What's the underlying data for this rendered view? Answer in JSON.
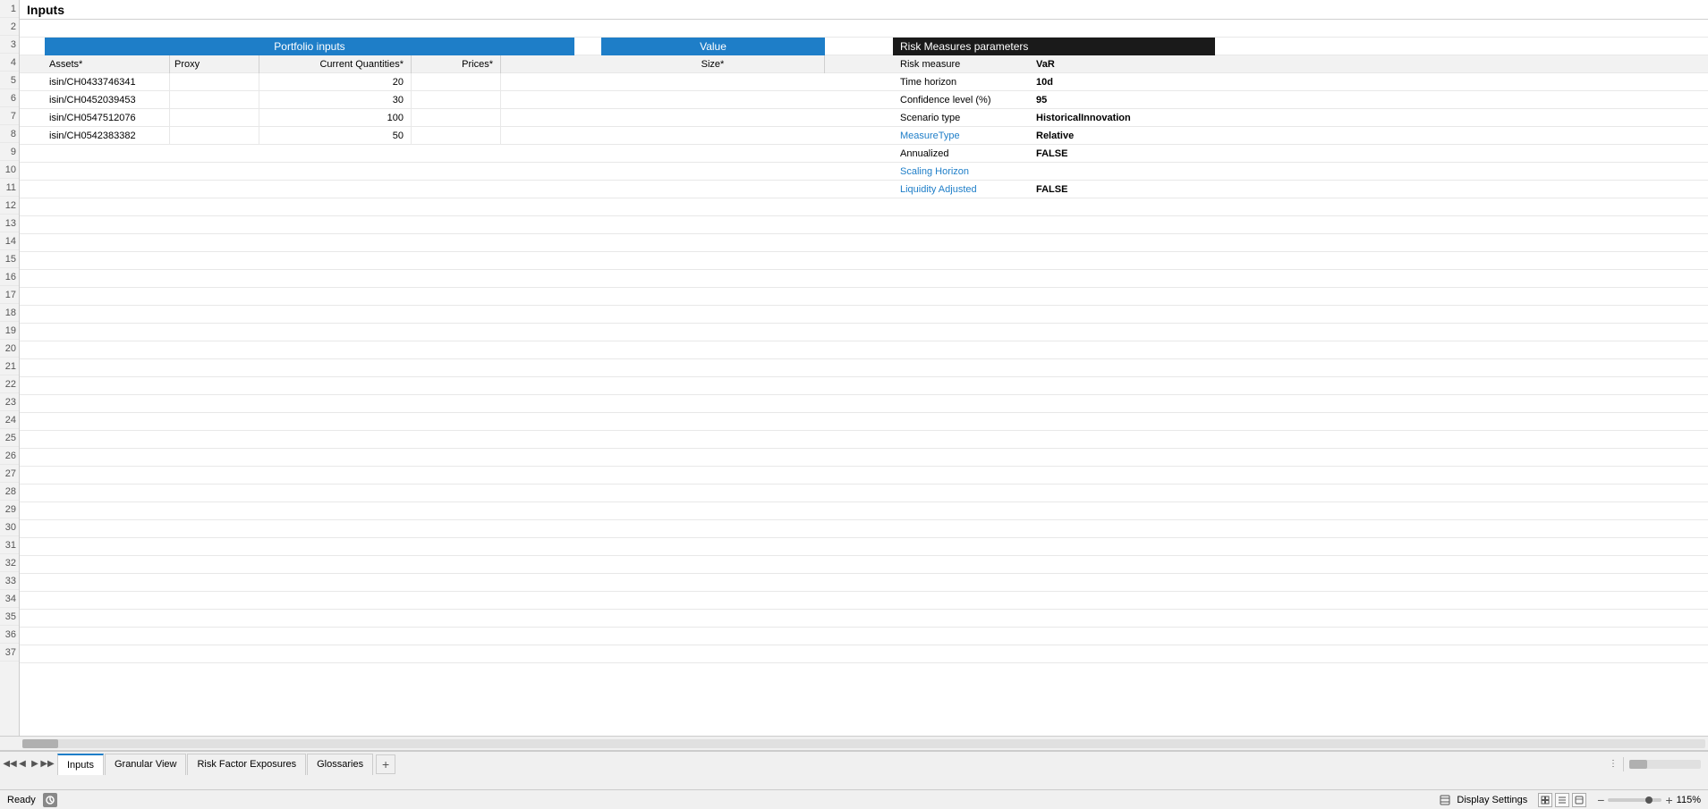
{
  "title": "Inputs",
  "portfolioTable": {
    "header": "Portfolio inputs",
    "columns": [
      "Assets*",
      "Proxy",
      "Current Quantities*",
      "Prices*"
    ],
    "rows": [
      {
        "assets": "isin/CH0433746341",
        "proxy": "",
        "quantities": "20",
        "prices": ""
      },
      {
        "assets": "isin/CH0452039453",
        "proxy": "",
        "quantities": "30",
        "prices": ""
      },
      {
        "assets": "isin/CH0547512076",
        "proxy": "",
        "quantities": "100",
        "prices": ""
      },
      {
        "assets": "isin/CH0542383382",
        "proxy": "",
        "quantities": "50",
        "prices": ""
      }
    ]
  },
  "valueTable": {
    "header": "Value",
    "columns": [
      "Size*"
    ]
  },
  "riskMeasures": {
    "header": "Risk Measures parameters",
    "params": [
      {
        "label": "Risk measure",
        "value": "VaR",
        "isBlue": false
      },
      {
        "label": "Time horizon",
        "value": "10d",
        "isBlue": false
      },
      {
        "label": "Confidence level (%)",
        "value": "95",
        "isBlue": false
      },
      {
        "label": "Scenario type",
        "value": "HistoricalInnovation",
        "isBlue": false
      },
      {
        "label": "MeasureType",
        "value": "Relative",
        "isBlue": true
      },
      {
        "label": "Annualized",
        "value": "FALSE",
        "isBlue": false
      },
      {
        "label": "Scaling Horizon",
        "value": "",
        "isBlue": true
      },
      {
        "label": "Liquidity Adjusted",
        "value": "FALSE",
        "isBlue": true
      }
    ]
  },
  "tabs": [
    {
      "label": "Inputs",
      "active": true
    },
    {
      "label": "Granular View",
      "active": false
    },
    {
      "label": "Risk Factor Exposures",
      "active": false
    },
    {
      "label": "Glossaries",
      "active": false
    }
  ],
  "tabAddLabel": "+",
  "status": {
    "ready": "Ready",
    "displaySettings": "Display Settings",
    "zoom": "115%"
  },
  "rowNumbers": [
    "1",
    "2",
    "3",
    "4",
    "5",
    "6",
    "7",
    "8",
    "9",
    "10",
    "11",
    "12",
    "13",
    "14",
    "15",
    "16",
    "17",
    "18",
    "19",
    "20",
    "21",
    "22",
    "23",
    "24",
    "25",
    "26",
    "27",
    "28",
    "29",
    "30",
    "31",
    "32",
    "33",
    "34",
    "35",
    "36",
    "37"
  ]
}
